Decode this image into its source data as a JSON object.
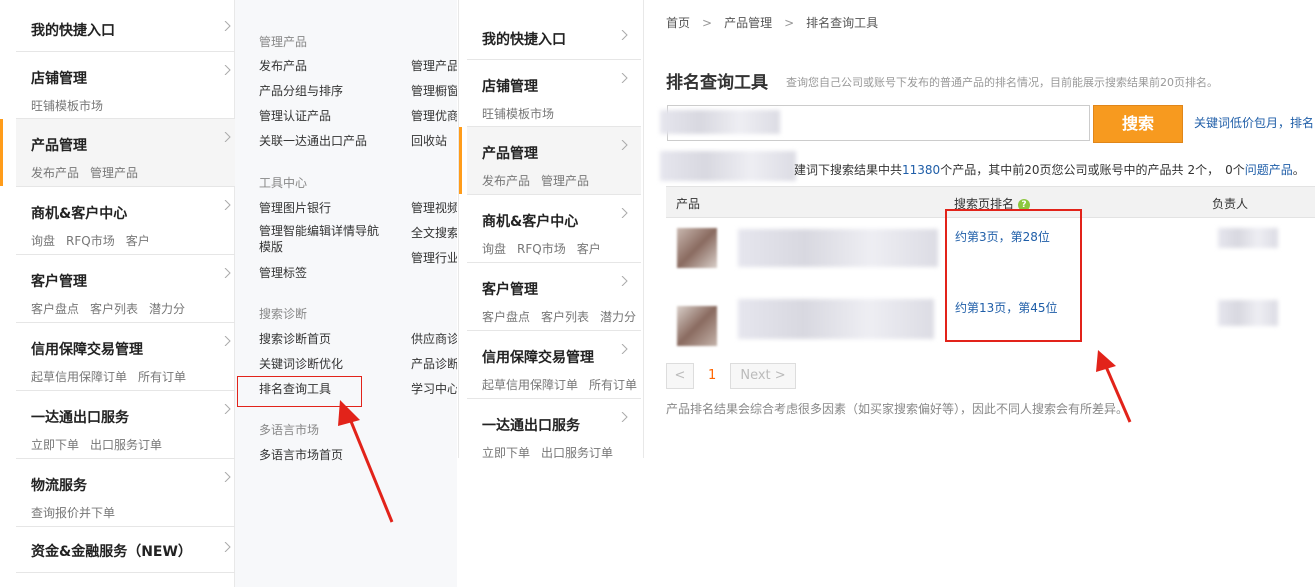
{
  "sidebar": {
    "items": [
      {
        "title": "我的快捷入口",
        "subs": []
      },
      {
        "title": "店铺管理",
        "subs": [
          "旺铺模板市场"
        ]
      },
      {
        "title": "产品管理",
        "subs": [
          "发布产品",
          "管理产品"
        ],
        "active": true
      },
      {
        "title": "商机&客户中心",
        "subs": [
          "询盘",
          "RFQ市场",
          "客户"
        ]
      },
      {
        "title": "客户管理",
        "subs": [
          "客户盘点",
          "客户列表",
          "潜力分"
        ]
      },
      {
        "title": "信用保障交易管理",
        "subs": [
          "起草信用保障订单",
          "所有订单"
        ]
      },
      {
        "title": "一达通出口服务",
        "subs": [
          "立即下单",
          "出口服务订单"
        ]
      },
      {
        "title": "物流服务",
        "subs": [
          "查询报价并下单"
        ]
      },
      {
        "title": "资金&金融服务（NEW）",
        "subs": []
      }
    ]
  },
  "submenu": {
    "sections": [
      {
        "heading": "管理产品",
        "links": [
          [
            "发布产品",
            "管理产品"
          ],
          [
            "产品分组与排序",
            "管理橱窗"
          ],
          [
            "管理认证产品",
            "管理优商"
          ],
          [
            "关联一达通出口产品",
            "回收站"
          ]
        ]
      },
      {
        "heading": "工具中心",
        "links": [
          [
            "管理图片银行",
            "管理视频"
          ],
          [
            "管理智能编辑详情导航模版",
            "全文搜索"
          ],
          [
            "",
            "管理行业"
          ],
          [
            "管理标签",
            ""
          ]
        ]
      },
      {
        "heading": "搜索诊断",
        "links": [
          [
            "搜索诊断首页",
            "供应商诊"
          ],
          [
            "关键词诊断优化",
            "产品诊断"
          ],
          [
            "排名查询工具",
            "学习中心"
          ]
        ]
      },
      {
        "heading": "多语言市场",
        "links": [
          [
            "多语言市场首页",
            ""
          ]
        ]
      }
    ]
  },
  "breadcrumb": [
    "首页",
    "产品管理",
    "排名查询工具"
  ],
  "page": {
    "title": "排名查询工具",
    "description": "查询您自己公司或账号下发布的普通产品的排名情况，目前能展示搜索结果前20页排名。"
  },
  "search": {
    "button_label": "搜索",
    "side_link": "关键词低价包月，排名"
  },
  "result": {
    "prefix": "建词下搜索结果中共",
    "total": "11380",
    "middle": "个产品，其中前20页您公司或账号中的产品共",
    "own": "2个",
    "sep": "，",
    "issue_count": "0个",
    "issue_link": "问题产品",
    "suffix": "。"
  },
  "table": {
    "headers": [
      "产品",
      "搜索页排名",
      "负责人"
    ],
    "rows": [
      {
        "rank": "约第3页，第28位"
      },
      {
        "rank": "约第13页，第45位"
      }
    ]
  },
  "pagination": {
    "prev": "<",
    "current": "1",
    "next": "Next >"
  },
  "note": "产品排名结果会综合考虑很多因素（如买家搜索偏好等），因此不同人搜索会有所差异。",
  "colors": {
    "accent": "#f79a1f",
    "link": "#1f5ea8",
    "highlight": "#e2231a"
  }
}
